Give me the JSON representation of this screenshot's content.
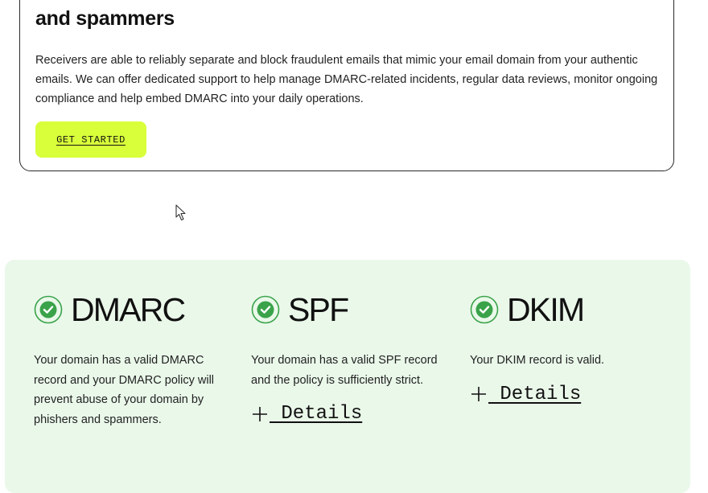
{
  "card": {
    "title": "and spammers",
    "body": "Receivers are able to reliably separate and block fraudulent emails that mimic your email domain from your authentic emails. We can offer dedicated support to help manage DMARC-related incidents, regular data reviews, monitor ongoing compliance and help embed DMARC into your daily operations.",
    "cta_label": "GET STARTED"
  },
  "results": [
    {
      "title": "DMARC",
      "description": "Your domain has a valid DMARC record and your DMARC policy will prevent abuse of your domain by phishers and spammers.",
      "details_label": " Details"
    },
    {
      "title": "SPF",
      "description": "Your domain has a valid SPF record and the policy is sufficiently strict.",
      "details_label": " Details"
    },
    {
      "title": "DKIM",
      "description": "Your DKIM record is valid.",
      "details_label": " Details"
    }
  ],
  "icons": {
    "status": "check-circle-icon",
    "expand": "plus-icon",
    "cursor": "mouse-pointer-icon"
  },
  "colors": {
    "cta_background": "#d8ff3a",
    "panel_background": "#eaf8ea",
    "check_green": "#3aa34a"
  }
}
